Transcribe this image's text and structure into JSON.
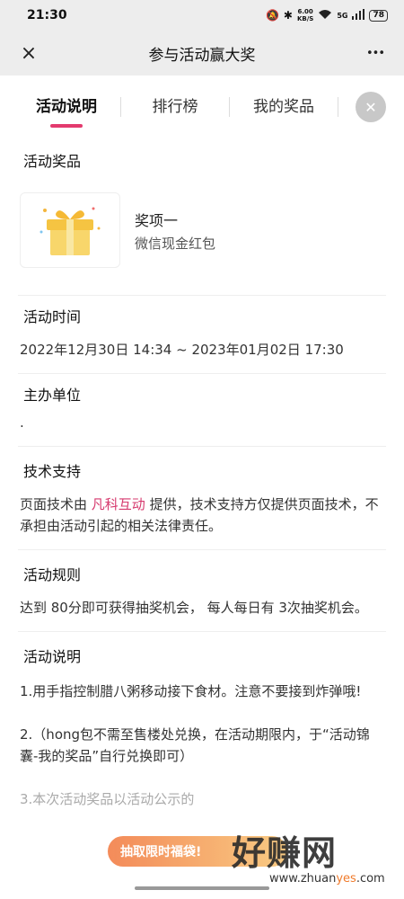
{
  "status": {
    "time": "21:30",
    "net_speed": "6.00",
    "net_unit": "KB/S",
    "signal": "5G",
    "battery": "78"
  },
  "nav": {
    "title": "参与活动赢大奖",
    "close_icon": "×",
    "more_icon": "•••"
  },
  "tabs": [
    {
      "label": "活动说明"
    },
    {
      "label": "排行榜"
    },
    {
      "label": "我的奖品"
    }
  ],
  "prize_section": {
    "title": "活动奖品",
    "prize_name": "奖项一",
    "prize_desc": "微信现金红包",
    "image_icon": "gift-box"
  },
  "time_section": {
    "title": "活动时间",
    "value": "2022年12月30日 14:34 ~ 2023年01月02日 17:30"
  },
  "organizer_section": {
    "title": "主办单位",
    "value": "."
  },
  "tech_section": {
    "title": "技术支持",
    "text_before": "页面技术由 ",
    "link": "凡科互动",
    "text_after": " 提供，技术支持方仅提供页面技术，不承担由活动引起的相关法律责任。"
  },
  "rules_section": {
    "title": "活动规则",
    "value": "达到 80分即可获得抽奖机会， 每人每日有 3次抽奖机会。"
  },
  "desc_section": {
    "title": "活动说明",
    "items": [
      "1.用手指控制腊八粥移动接下食材。注意不要接到炸弹哦!",
      "2.（hong包不需至售楼处兑换，在活动期限内，于“活动锦囊-我的奖品”自行兑换即可）",
      "3.本次活动奖品以活动公示的"
    ]
  },
  "watermark": {
    "promo": "抽取限时福袋!",
    "logo": "好赚网",
    "url_prefix": "www.zhuan",
    "url_accent": "yes",
    "url_suffix": ".com"
  },
  "colors": {
    "accent": "#e33a6e",
    "highlight": "#fde8ec"
  }
}
